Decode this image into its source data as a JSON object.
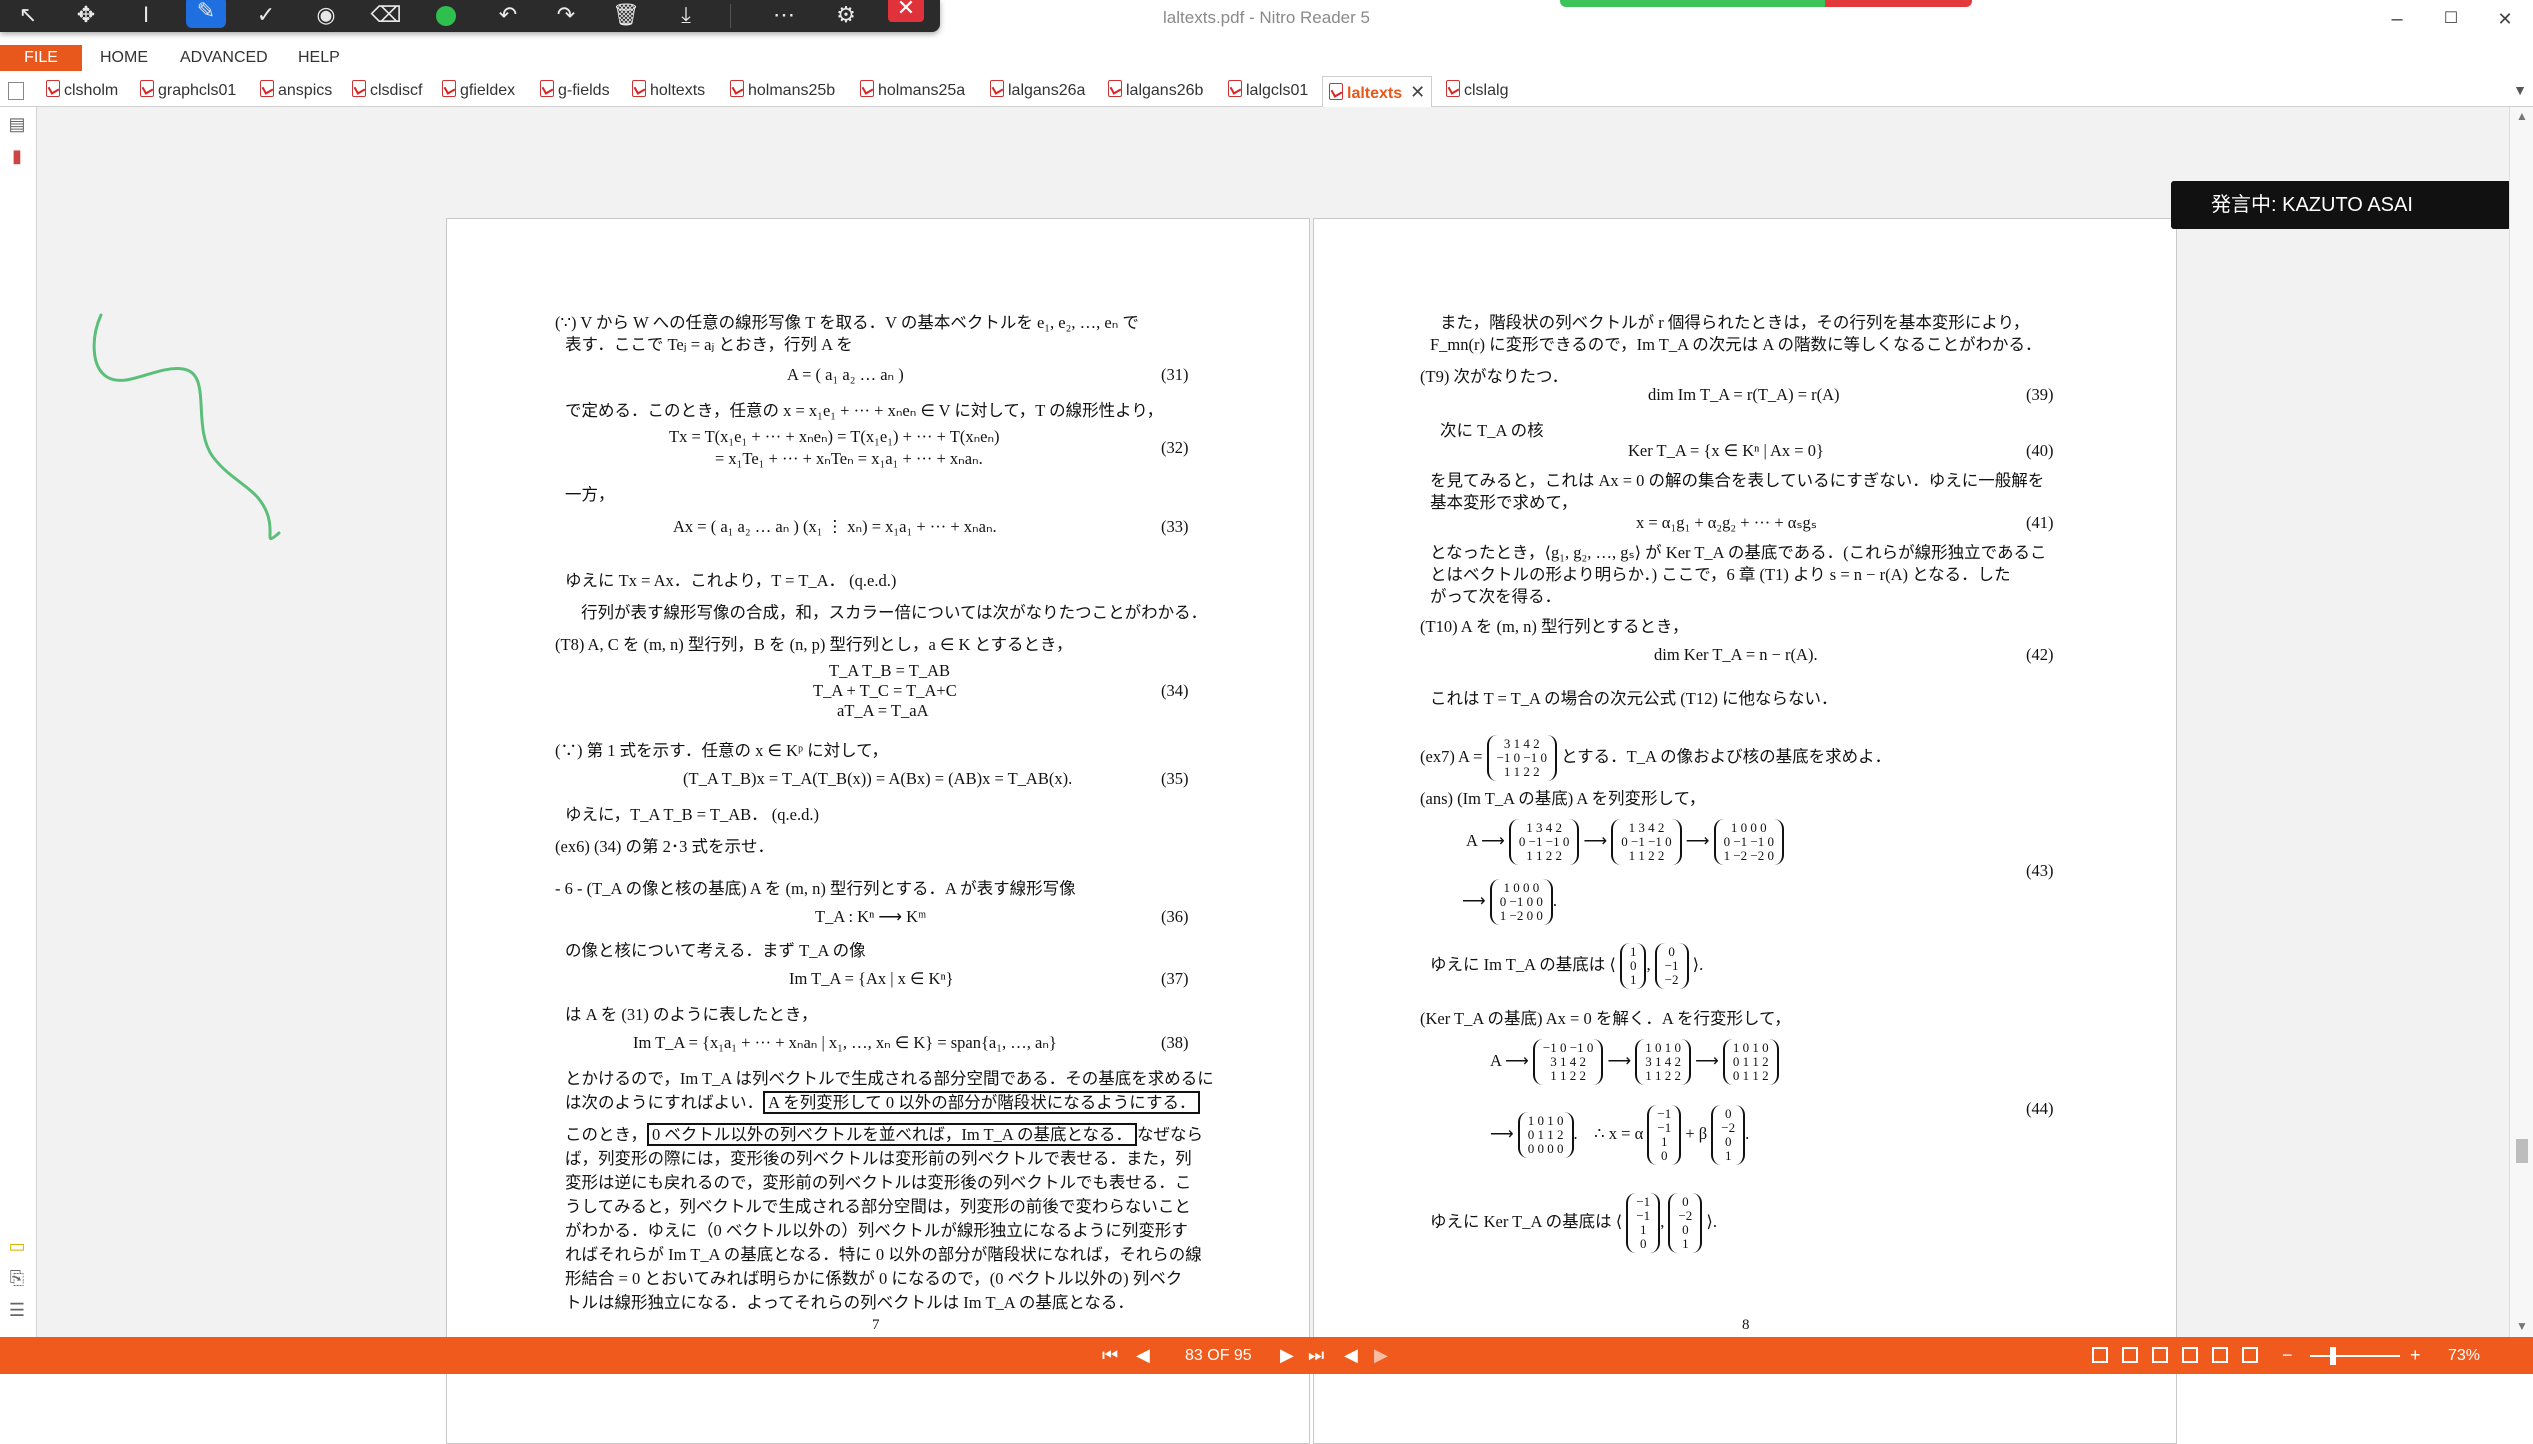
{
  "window": {
    "title": "laltexts.pdf - Nitro Reader 5",
    "minimize": "–",
    "maximize": "☐",
    "close": "✕"
  },
  "menu": {
    "file": "FILE",
    "home": "HOME",
    "advanced": "ADVANCED",
    "help": "HELP"
  },
  "tabs": [
    {
      "label": "clsholm"
    },
    {
      "label": "graphcls01"
    },
    {
      "label": "anspics"
    },
    {
      "label": "clsdiscf"
    },
    {
      "label": "gfieldex"
    },
    {
      "label": "g-fields"
    },
    {
      "label": "holtexts"
    },
    {
      "label": "holmans25b"
    },
    {
      "label": "holmans25a"
    },
    {
      "label": "lalgans26a"
    },
    {
      "label": "lalgans26b"
    },
    {
      "label": "lalgcls01"
    },
    {
      "label": "laltexts"
    },
    {
      "label": "clslalg"
    }
  ],
  "active_tab": "laltexts",
  "speaker": "発言中: KAZUTO ASAI",
  "status": {
    "page_indicator": "83 OF 95",
    "zoom": "73%",
    "zoom_level": 0.25,
    "zoom_minus": "−",
    "zoom_plus": "+"
  },
  "colors": {
    "accent": "#f05a1d",
    "pen": "#1f6fe0",
    "ink": "#5bbf7a"
  },
  "page7": {
    "number": "7",
    "lines": {
      "l1": "(∵) V から W への任意の線形写像 T を取る．V の基本ベクトルを e₁, e₂, …, eₙ で",
      "l2": "表す．ここで Teⱼ = aⱼ とおき，行列 A を",
      "eq31": "A = ( a₁   a₂   …   aₙ )",
      "n31": "(31)",
      "l3": "で定める．このとき，任意の x = x₁e₁ + ··· + xₙeₙ ∈ V に対して，T の線形性より，",
      "eq32a": "Tx   = T(x₁e₁ + ··· + xₙeₙ) = T(x₁e₁) + ··· + T(xₙeₙ)",
      "eq32b": "= x₁Te₁ + ··· + xₙTeₙ = x₁a₁ + ··· + xₙaₙ.",
      "n32": "(32)",
      "l4": "一方，",
      "eq33": "Ax = ( a₁   a₂   …   aₙ ) (x₁ ⋮ xₙ) = x₁a₁ + ··· + xₙaₙ.",
      "n33": "(33)",
      "l5": "ゆえに Tx = Ax．これより，T = T_A．  (q.e.d.)",
      "l6": "行列が表す線形写像の合成，和，スカラー倍については次がなりたつことがわかる．",
      "l7": "(T8)  A, C を (m, n) 型行列，B を (n, p) 型行列とし，a ∈ K とするとき，",
      "eq34a": "T_A T_B = T_AB",
      "eq34b": "T_A + T_C = T_A+C",
      "eq34c": "aT_A = T_aA",
      "n34": "(34)",
      "l8": "(∵) 第 1 式を示す．任意の x ∈ Kᵖ に対して，",
      "eq35": "(T_A T_B)x = T_A(T_B(x)) = A(Bx) = (AB)x = T_AB(x).",
      "n35": "(35)",
      "l9": "ゆえに，T_A T_B = T_AB．  (q.e.d.)",
      "l10": "(ex6)  (34) の第 2･3 式を示せ．",
      "l11": "- 6 - (T_A の像と核の基底) A を (m, n) 型行列とする．A が表す線形写像",
      "eq36": "T_A : Kⁿ ⟶ Kᵐ",
      "n36": "(36)",
      "l12": "の像と核について考える．まず T_A の像",
      "eq37": "Im T_A = {Ax | x ∈ Kⁿ}",
      "n37": "(37)",
      "l13": "は A を (31) のように表したとき，",
      "eq38": "Im T_A = {x₁a₁ + ··· + xₙaₙ | x₁, …, xₙ ∈ K} = span{a₁, …, aₙ}",
      "n38": "(38)",
      "l14": "とかけるので，Im T_A は列ベクトルで生成される部分空間である．その基底を求めるに",
      "l15a": "は次のようにすればよい．",
      "l15b": "A を列変形して 0 以外の部分が階段状になるようにする．",
      "l16a": "このとき，",
      "l16b": "0 ベクトル以外の列ベクトルを並べれば，Im T_A の基底となる．",
      "l16c": "なぜなら",
      "l17": "ば，列変形の際には，変形後の列ベクトルは変形前の列ベクトルで表せる．また，列",
      "l18": "変形は逆にも戻れるので，変形前の列ベクトルは変形後の列ベクトルでも表せる．こ",
      "l19": "うしてみると，列ベクトルで生成される部分空間は，列変形の前後で変わらないこと",
      "l20": "がわかる．ゆえに（0 ベクトル以外の）列ベクトルが線形独立になるように列変形す",
      "l21": "ればそれらが Im T_A の基底となる．特に 0 以外の部分が階段状になれば，それらの線",
      "l22": "形結合 = 0 とおいてみれば明らかに係数が 0 になるので，(0 ベクトル以外の) 列ベク",
      "l23": "トルは線形独立になる．よってそれらの列ベクトルは Im T_A の基底となる．"
    }
  },
  "page8": {
    "number": "8",
    "lines": {
      "l1": "また，階段状の列ベクトルが r 個得られたときは，その行列を基本変形により，",
      "l2": "F_mn(r) に変形できるので，Im T_A の次元は A の階数に等しくなることがわかる．",
      "l3": "(T9)  次がなりたつ．",
      "eq39": "dim Im T_A = r(T_A) = r(A)",
      "n39": "(39)",
      "l4": "次に T_A の核",
      "eq40": "Ker T_A = {x ∈ Kⁿ | Ax = 0}",
      "n40": "(40)",
      "l5": "を見てみると，これは Ax = 0 の解の集合を表しているにすぎない．ゆえに一般解を",
      "l6": "基本変形で求めて，",
      "eq41": "x = α₁g₁ + α₂g₂ + ··· + αₛgₛ",
      "n41": "(41)",
      "l7": "となったとき，⟨g₁, g₂, …, gₛ⟩ が Ker T_A の基底である．(これらが線形独立であるこ",
      "l8": "とはベクトルの形より明らか．) ここで，6 章 (T1) より s = n − r(A) となる．した",
      "l9": "がって次を得る．",
      "l10": "(T10)  A を (m, n) 型行列とするとき，",
      "eq42": "dim Ker T_A = n − r(A).",
      "n42": "(42)",
      "l11": "これは T = T_A の場合の次元公式 (T12) に他ならない．",
      "ex7a": "(ex7)  A =",
      "ex7b": "とする．T_A の像および核の基底を求めよ．",
      "l12": "(ans)  (Im T_A の基底) A を列変形して，",
      "eq43a": "A ⟶",
      "n43": "(43)",
      "l13a": "ゆえに Im T_A の基底は ⟨",
      "l13b": "⟩.",
      "l14": "(Ker T_A の基底)  Ax = 0 を解く．A を行変形して，",
      "eq44a": "A ⟶",
      "eq44x": "∴  x = α",
      "eq44p": "+ β",
      "n44": "(44)",
      "l15a": "ゆえに Ker T_A の基底は ⟨",
      "l15b": "⟩."
    },
    "matrices": {
      "ex7": [
        "3  1  4  2",
        "−1  0  −1  0",
        "1  1  2  2"
      ],
      "m43_1": [
        "1  3  4  2",
        "0  −1  −1  0",
        "1  1  2  2"
      ],
      "m43_2": [
        "1  3  4  2",
        "0  −1  −1  0",
        "1  1  2  2"
      ],
      "m43_3": [
        "1  0  0  0",
        "0  −1  −1  0",
        "1  −2  −2  0"
      ],
      "m43_4": [
        "1  0  0  0",
        "0  −1  0  0",
        "1  −2  0  0"
      ],
      "im_v1": [
        "1",
        "0",
        "1"
      ],
      "im_v2": [
        "0",
        "−1",
        "−2"
      ],
      "m44_1": [
        "−1  0  −1  0",
        "3  1  4  2",
        "1  1  2  2"
      ],
      "m44_2": [
        "1  0  1  0",
        "3  1  4  2",
        "1  1  2  2"
      ],
      "m44_3": [
        "1  0  1  0",
        "0  1  1  2",
        "0  1  1  2"
      ],
      "m44_4": [
        "1  0  1  0",
        "0  1  1  2",
        "0  0  0  0"
      ],
      "k_v1": [
        "−1",
        "−1",
        "1",
        "0"
      ],
      "k_v2": [
        "0",
        "−2",
        "0",
        "1"
      ]
    }
  }
}
